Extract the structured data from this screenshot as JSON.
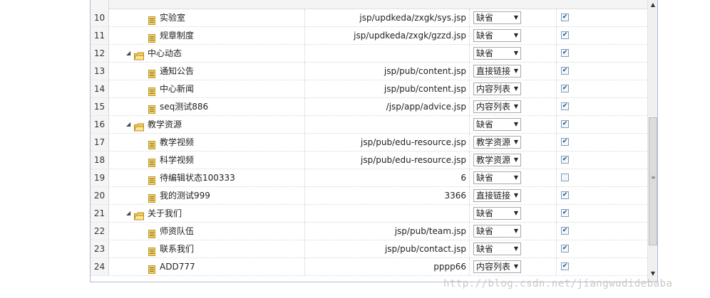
{
  "rows": [
    {
      "num": "10",
      "name": "实验室",
      "kind": "page",
      "url": "jsp/updkeda/zxgk/sys.jsp",
      "type": "缺省",
      "checked": true
    },
    {
      "num": "11",
      "name": "规章制度",
      "kind": "page",
      "url": "jsp/updkeda/zxgk/gzzd.jsp",
      "type": "缺省",
      "checked": true
    },
    {
      "num": "12",
      "name": "中心动态",
      "kind": "folder",
      "url": "",
      "type": "缺省",
      "checked": true
    },
    {
      "num": "13",
      "name": "通知公告",
      "kind": "page",
      "url": "jsp/pub/content.jsp",
      "type": "直接链接",
      "checked": true
    },
    {
      "num": "14",
      "name": "中心新闻",
      "kind": "page",
      "url": "jsp/pub/content.jsp",
      "type": "内容列表",
      "checked": true
    },
    {
      "num": "15",
      "name": "seq测试886",
      "kind": "page",
      "url": "/jsp/app/advice.jsp",
      "type": "内容列表",
      "checked": true
    },
    {
      "num": "16",
      "name": "教学资源",
      "kind": "folder",
      "url": "",
      "type": "缺省",
      "checked": true
    },
    {
      "num": "17",
      "name": "教学视频",
      "kind": "page",
      "url": "jsp/pub/edu-resource.jsp",
      "type": "教学资源",
      "checked": true
    },
    {
      "num": "18",
      "name": "科学视频",
      "kind": "page",
      "url": "jsp/pub/edu-resource.jsp",
      "type": "教学资源",
      "checked": true
    },
    {
      "num": "19",
      "name": "待编辑状态100333",
      "kind": "page",
      "url": "6",
      "type": "缺省",
      "checked": false
    },
    {
      "num": "20",
      "name": "我的测试999",
      "kind": "page",
      "url": "3366",
      "type": "直接链接",
      "checked": true
    },
    {
      "num": "21",
      "name": "关于我们",
      "kind": "folder",
      "url": "",
      "type": "缺省",
      "checked": true
    },
    {
      "num": "22",
      "name": "师资队伍",
      "kind": "page",
      "url": "jsp/pub/team.jsp",
      "type": "缺省",
      "checked": true
    },
    {
      "num": "23",
      "name": "联系我们",
      "kind": "page",
      "url": "jsp/pub/contact.jsp",
      "type": "缺省",
      "checked": true
    },
    {
      "num": "24",
      "name": "ADD777",
      "kind": "page",
      "url": "pppp66",
      "type": "内容列表",
      "checked": true
    }
  ],
  "watermark": "http://blog.csdn.net/jiangwudidebaba",
  "colors": {
    "border": "#a8bdd6",
    "page_icon": "#f2d36b",
    "folder_icon": "#f5cf58",
    "check": "#21488f"
  },
  "icons": {
    "page": "document-icon",
    "folder": "folder-open-icon",
    "toggle": "expand-triangle-icon",
    "select_arrow": "dropdown-arrow-icon",
    "check": "checkbox-icon"
  }
}
